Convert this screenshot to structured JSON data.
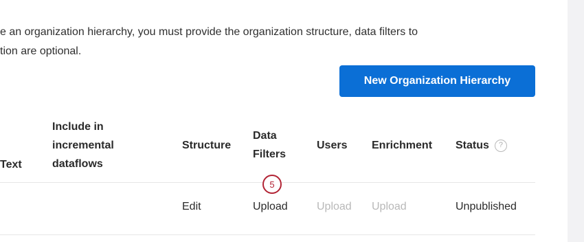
{
  "description": {
    "line1": "e an organization hierarchy, you must provide the organization structure, data filters to",
    "line2": "tion are optional."
  },
  "toolbar": {
    "new_button_label": "New Organization Hierarchy"
  },
  "table": {
    "headers": {
      "text": "Text",
      "include": "Include in\nincremental\ndataflows",
      "structure": "Structure",
      "data_filters": "Data\nFilters",
      "users": "Users",
      "enrichment": "Enrichment",
      "status": "Status",
      "status_help_icon": "question-mark-icon"
    },
    "rows": [
      {
        "structure": "Edit",
        "data_filters": "Upload",
        "users": "Upload",
        "enrichment": "Upload",
        "status": "Unpublished"
      }
    ]
  },
  "step_marker": {
    "number": "5",
    "color": "#b22334"
  },
  "colors": {
    "primary_button": "#0b6fd6",
    "disabled_text": "#b8b8b8"
  }
}
